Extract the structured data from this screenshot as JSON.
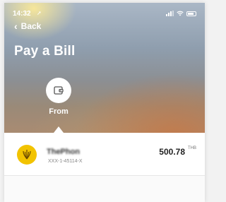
{
  "status_bar": {
    "time": "14:32",
    "icons": [
      "location-arrow-icon",
      "signal-icon",
      "wifi-icon",
      "battery-icon"
    ]
  },
  "nav": {
    "back_label": "Back",
    "back_icon": "chevron-left-icon"
  },
  "title": "Pay a Bill",
  "from_section": {
    "label": "From",
    "icon": "wallet-icon"
  },
  "account": {
    "name": "ThePhon",
    "number": "XXX-1-45114-X",
    "balance": "500.78",
    "currency": "THB",
    "logo_icon": "bank-logo-icon",
    "logo_color": "#f2c300"
  },
  "colors": {
    "header_text": "#ffffff",
    "card_background": "#ffffff"
  }
}
